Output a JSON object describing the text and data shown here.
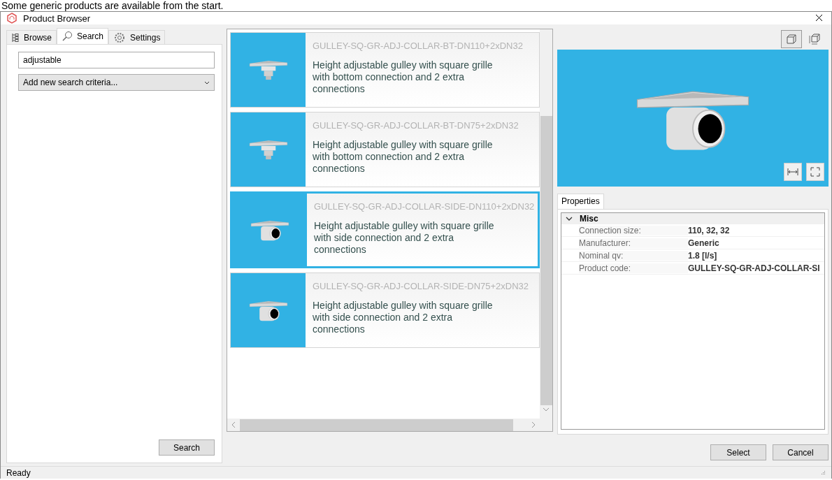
{
  "caption": "Some generic products are available from the start.",
  "window": {
    "title": "Product Browser"
  },
  "tabs": [
    {
      "label": "Browse",
      "kind": "tree",
      "selected": false
    },
    {
      "label": "Search",
      "kind": "search",
      "selected": true
    },
    {
      "label": "Settings",
      "kind": "gear",
      "selected": false
    }
  ],
  "search": {
    "value": "adjustable",
    "criteria_dropdown": "Add new search criteria...",
    "button": "Search"
  },
  "products": [
    {
      "code": "GULLEY-SQ-GR-ADJ-COLLAR-BT-DN110+2xDN32",
      "description": "Height adjustable gulley with square grille with bottom connection and 2 extra connections",
      "kind": "bottom",
      "selected": false
    },
    {
      "code": "GULLEY-SQ-GR-ADJ-COLLAR-BT-DN75+2xDN32",
      "description": "Height adjustable gulley with square grille with bottom connection and 2 extra connections",
      "kind": "bottom",
      "selected": false
    },
    {
      "code": "GULLEY-SQ-GR-ADJ-COLLAR-SIDE-DN110+2xDN32",
      "description": "Height adjustable gulley with square grille with side connection and 2 extra connections",
      "kind": "side",
      "selected": true
    },
    {
      "code": "GULLEY-SQ-GR-ADJ-COLLAR-SIDE-DN75+2xDN32",
      "description": "Height adjustable gulley with square grille with side connection and 2 extra connections",
      "kind": "side",
      "selected": false
    }
  ],
  "view_buttons": [
    {
      "kind": "solid",
      "selected": true
    },
    {
      "kind": "dimensions",
      "selected": false
    }
  ],
  "properties": {
    "tab": "Properties",
    "category": "Misc",
    "expanded": true,
    "rows": [
      {
        "label": "Connection size:",
        "value": "110, 32, 32"
      },
      {
        "label": "Manufacturer:",
        "value": "Generic"
      },
      {
        "label": "Nominal qv:",
        "value": "1.8 [l/s]"
      },
      {
        "label": "Product code:",
        "value": "GULLEY-SQ-GR-ADJ-COLLAR-SI"
      }
    ]
  },
  "buttons": [
    "Select",
    "Cancel"
  ],
  "status": "Ready"
}
